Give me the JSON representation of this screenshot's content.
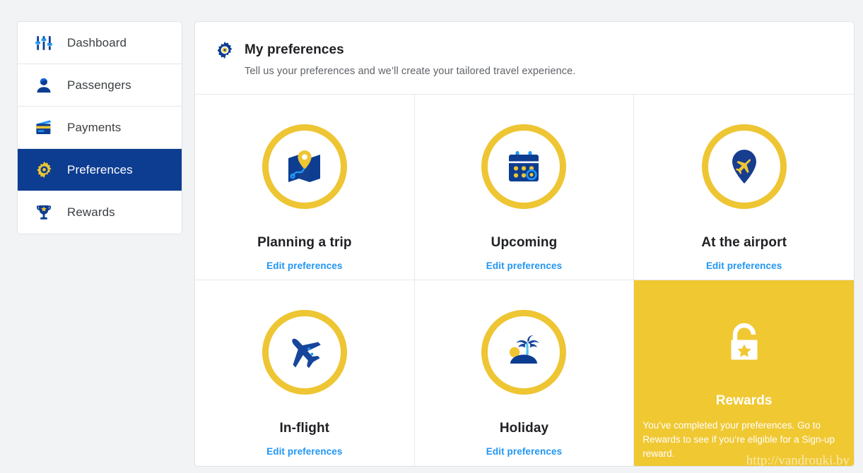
{
  "colors": {
    "brand_navy": "#0d3d91",
    "brand_yellow": "#eec533",
    "card_yellow": "#f0c832",
    "link_blue": "#2196f3",
    "page_bg": "#f1f3f4",
    "border": "#e5e8ec"
  },
  "sidebar": {
    "items": [
      {
        "label": "Dashboard",
        "icon": "sliders-icon",
        "active": false
      },
      {
        "label": "Passengers",
        "icon": "person-icon",
        "active": false
      },
      {
        "label": "Payments",
        "icon": "credit-card-icon",
        "active": false
      },
      {
        "label": "Preferences",
        "icon": "gear-icon",
        "active": true
      },
      {
        "label": "Rewards",
        "icon": "trophy-icon",
        "active": false
      }
    ]
  },
  "panel": {
    "icon": "gear-icon",
    "title": "My preferences",
    "subtitle": "Tell us your preferences and we’ll create your tailored travel experience."
  },
  "cards": [
    {
      "title": "Planning a trip",
      "link": "Edit preferences",
      "icon": "map-pin-icon"
    },
    {
      "title": "Upcoming",
      "link": "Edit preferences",
      "icon": "calendar-icon"
    },
    {
      "title": "At the airport",
      "link": "Edit preferences",
      "icon": "pin-plane-icon"
    },
    {
      "title": "In-flight",
      "link": "Edit preferences",
      "icon": "airplane-icon"
    },
    {
      "title": "Holiday",
      "link": "Edit preferences",
      "icon": "palm-island-icon"
    }
  ],
  "reward_card": {
    "icon": "padlock-star-icon",
    "title": "Rewards",
    "text": "You’ve completed your preferences. Go to Rewards to see if you’re eligible for a Sign-up reward."
  },
  "watermark": {
    "text": "http://vandrouki.by"
  }
}
